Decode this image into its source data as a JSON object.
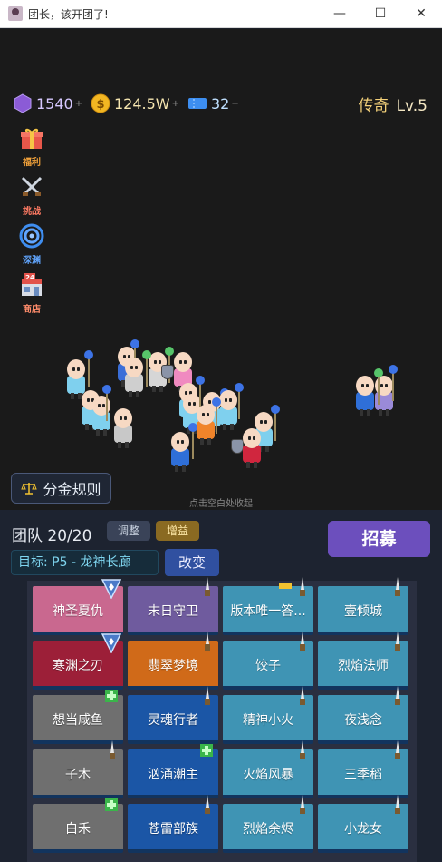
{
  "window": {
    "title": "团长，该开团了!",
    "minimize": "—",
    "maximize": "☐",
    "close": "✕"
  },
  "resources": {
    "gems": "1540",
    "gold": "124.5W",
    "tickets": "32",
    "plus": "+"
  },
  "rank": {
    "tier": "传奇",
    "level": "Lv.5"
  },
  "sidebar": {
    "items": [
      {
        "label": "福利",
        "icon": "gift-icon",
        "color": "#f2a23a"
      },
      {
        "label": "挑战",
        "icon": "crossed-swords-icon",
        "color": "#ff7a63"
      },
      {
        "label": "深渊",
        "icon": "vortex-icon",
        "color": "#61a6ff"
      },
      {
        "label": "商店",
        "icon": "shop-icon",
        "color": "#ff8c6b"
      }
    ]
  },
  "battlefield": {
    "rule_button": "分金规则",
    "hint": "点击空白处收起"
  },
  "team": {
    "title": "团队 20/20",
    "adjust_button": "调整",
    "buff_button": "增益",
    "target": "目标: P5 - 龙神长廊",
    "change_button": "改变",
    "recruit_button": "招募"
  },
  "members": [
    {
      "name": "神圣夏仇",
      "color": "#c9688f",
      "badge": "triangle"
    },
    {
      "name": "末日守卫",
      "color": "#6f5b9e",
      "badge": "dagger"
    },
    {
      "name": "版本唯一答...",
      "color": "#3f94b4",
      "badge": "dagger-crown"
    },
    {
      "name": "壹倾城",
      "color": "#3f94b4",
      "badge": "dagger"
    },
    {
      "name": "寒渊之刃",
      "color": "#9c1f38",
      "badge": "triangle"
    },
    {
      "name": "翡翠梦境",
      "color": "#d06a19",
      "badge": "dagger"
    },
    {
      "name": "饺子",
      "color": "#3f94b4",
      "badge": "dagger"
    },
    {
      "name": "烈焰法师",
      "color": "#3f94b4",
      "badge": "dagger"
    },
    {
      "name": "想当咸鱼",
      "color": "#6f6f6f",
      "badge": "plus"
    },
    {
      "name": "灵魂行者",
      "color": "#1b56a6",
      "badge": "dagger"
    },
    {
      "name": "精神小火",
      "color": "#3f94b4",
      "badge": "dagger"
    },
    {
      "name": "夜浅念",
      "color": "#3f94b4",
      "badge": "dagger"
    },
    {
      "name": "子木",
      "color": "#6f6f6f",
      "badge": "dagger"
    },
    {
      "name": "汹涌潮主",
      "color": "#1b56a6",
      "badge": "plus"
    },
    {
      "name": "火焰风暴",
      "color": "#3f94b4",
      "badge": "dagger"
    },
    {
      "name": "三季稻",
      "color": "#3f94b4",
      "badge": "dagger"
    },
    {
      "name": "白禾",
      "color": "#6f6f6f",
      "badge": "plus"
    },
    {
      "name": "苍雷部族",
      "color": "#1b56a6",
      "badge": "dagger"
    },
    {
      "name": "烈焰余烬",
      "color": "#3f94b4",
      "badge": "dagger"
    },
    {
      "name": "小龙女",
      "color": "#3f94b4",
      "badge": "dagger"
    }
  ]
}
